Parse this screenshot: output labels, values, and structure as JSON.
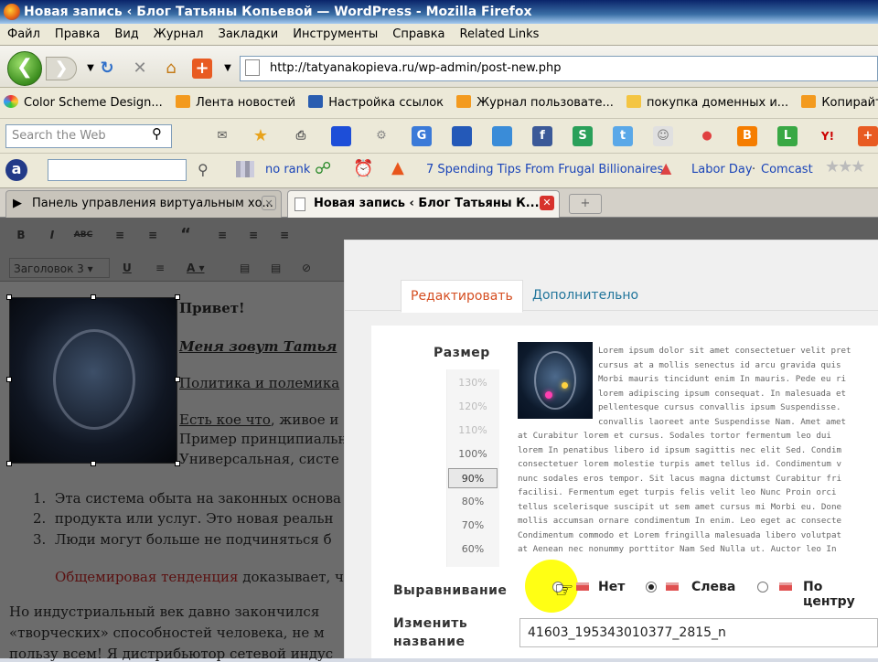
{
  "window": {
    "title": "Новая запись ‹ Блог Татьяны Копьевой — WordPress - Mozilla Firefox"
  },
  "menu": [
    "Файл",
    "Правка",
    "Вид",
    "Журнал",
    "Закладки",
    "Инструменты",
    "Справка",
    "Related Links"
  ],
  "address": {
    "url": "http://tatyanakopieva.ru/wp-admin/post-new.php"
  },
  "bookmarks": [
    "Color Scheme Design...",
    "Лента новостей",
    "Настройка ссылок",
    "Журнал пользовате...",
    "покупка доменных и...",
    "Копирайтинг о гла"
  ],
  "search": {
    "placeholder": "Search the Web"
  },
  "toolbar3": {
    "norank": "no rank",
    "tips": "7 Spending Tips From Frugal Billionaires",
    "laborday": "Labor Day",
    "comcast": "Comcast"
  },
  "tabs": [
    "Панель управления виртуальным хо...",
    "Новая запись ‹ Блог Татьяны К..."
  ],
  "editor": {
    "heading_select": "Заголовок 3",
    "greeting": "Привет!",
    "intro": "Меня зовут Татья",
    "line1": "Политика и полемика",
    "line2_link": "Есть кое что",
    "line2_rest": ", живое и",
    "line3": "Пример принципиальн",
    "line4": "Универсальная, систе",
    "list": [
      "Эта система обыта на законных основа",
      "продукта или услуг. Это новая реальн",
      "Люди могут больше не подчиняться б"
    ],
    "red_text": "Общемировая тенденция",
    "red_after": " доказывает, ч",
    "para1": "Но индустриальный век давно закончился",
    "para2": "«творческих» способностей человека, не м",
    "para3": "пользу всем! Я дистрибьютор сетевой индус"
  },
  "dialog": {
    "tab_edit": "Редактировать",
    "tab_more": "Дополнительно",
    "size_label": "Размер",
    "sizes": [
      "130%",
      "120%",
      "110%",
      "100%",
      "90%",
      "80%",
      "70%",
      "60%"
    ],
    "selected_size": "90%",
    "align_label": "Выравнивание",
    "align_none": "Нет",
    "align_left": "Слева",
    "align_center": "По центру",
    "rename_label_1": "Изменить",
    "rename_label_2": "название",
    "filename": "41603_195343010377_2815_n",
    "lorem": [
      "Lorem ipsum dolor sit amet consectetuer velit pret",
      "cursus at a mollis senectus id arcu gravida quis",
      "Morbi mauris tincidunt enim In mauris. Pede eu ri",
      "lorem adipiscing ipsum consequat. In malesuada et",
      "pellentesque cursus convallis ipsum Suspendisse.",
      "convallis laoreet ante Suspendisse Nam. Amet amet",
      "at Curabitur lorem et cursus. Sodales tortor fermentum leo dui",
      "lorem In penatibus libero id ipsum sagittis nec elit Sed. Condim",
      "consectetuer lorem molestie turpis amet tellus id. Condimentum v",
      "nunc sodales eros tempor. Sit lacus magna dictumst Curabitur fri",
      "facilisi. Fermentum eget turpis felis velit leo Nunc Proin orci",
      "tellus scelerisque suscipit ut sem amet cursus mi Morbi eu. Done",
      "mollis accumsan ornare condimentum In enim. Leo eget ac consecte",
      "Condimentum commodo et Lorem fringilla malesuada libero volutpat",
      "at Aenean nec nonummy porttitor Nam Sed Nulla ut. Auctor leo In"
    ]
  },
  "colors": {
    "accent_orange": "#d54e21",
    "link_blue": "#21759b",
    "titlebar": "#0a246a"
  }
}
